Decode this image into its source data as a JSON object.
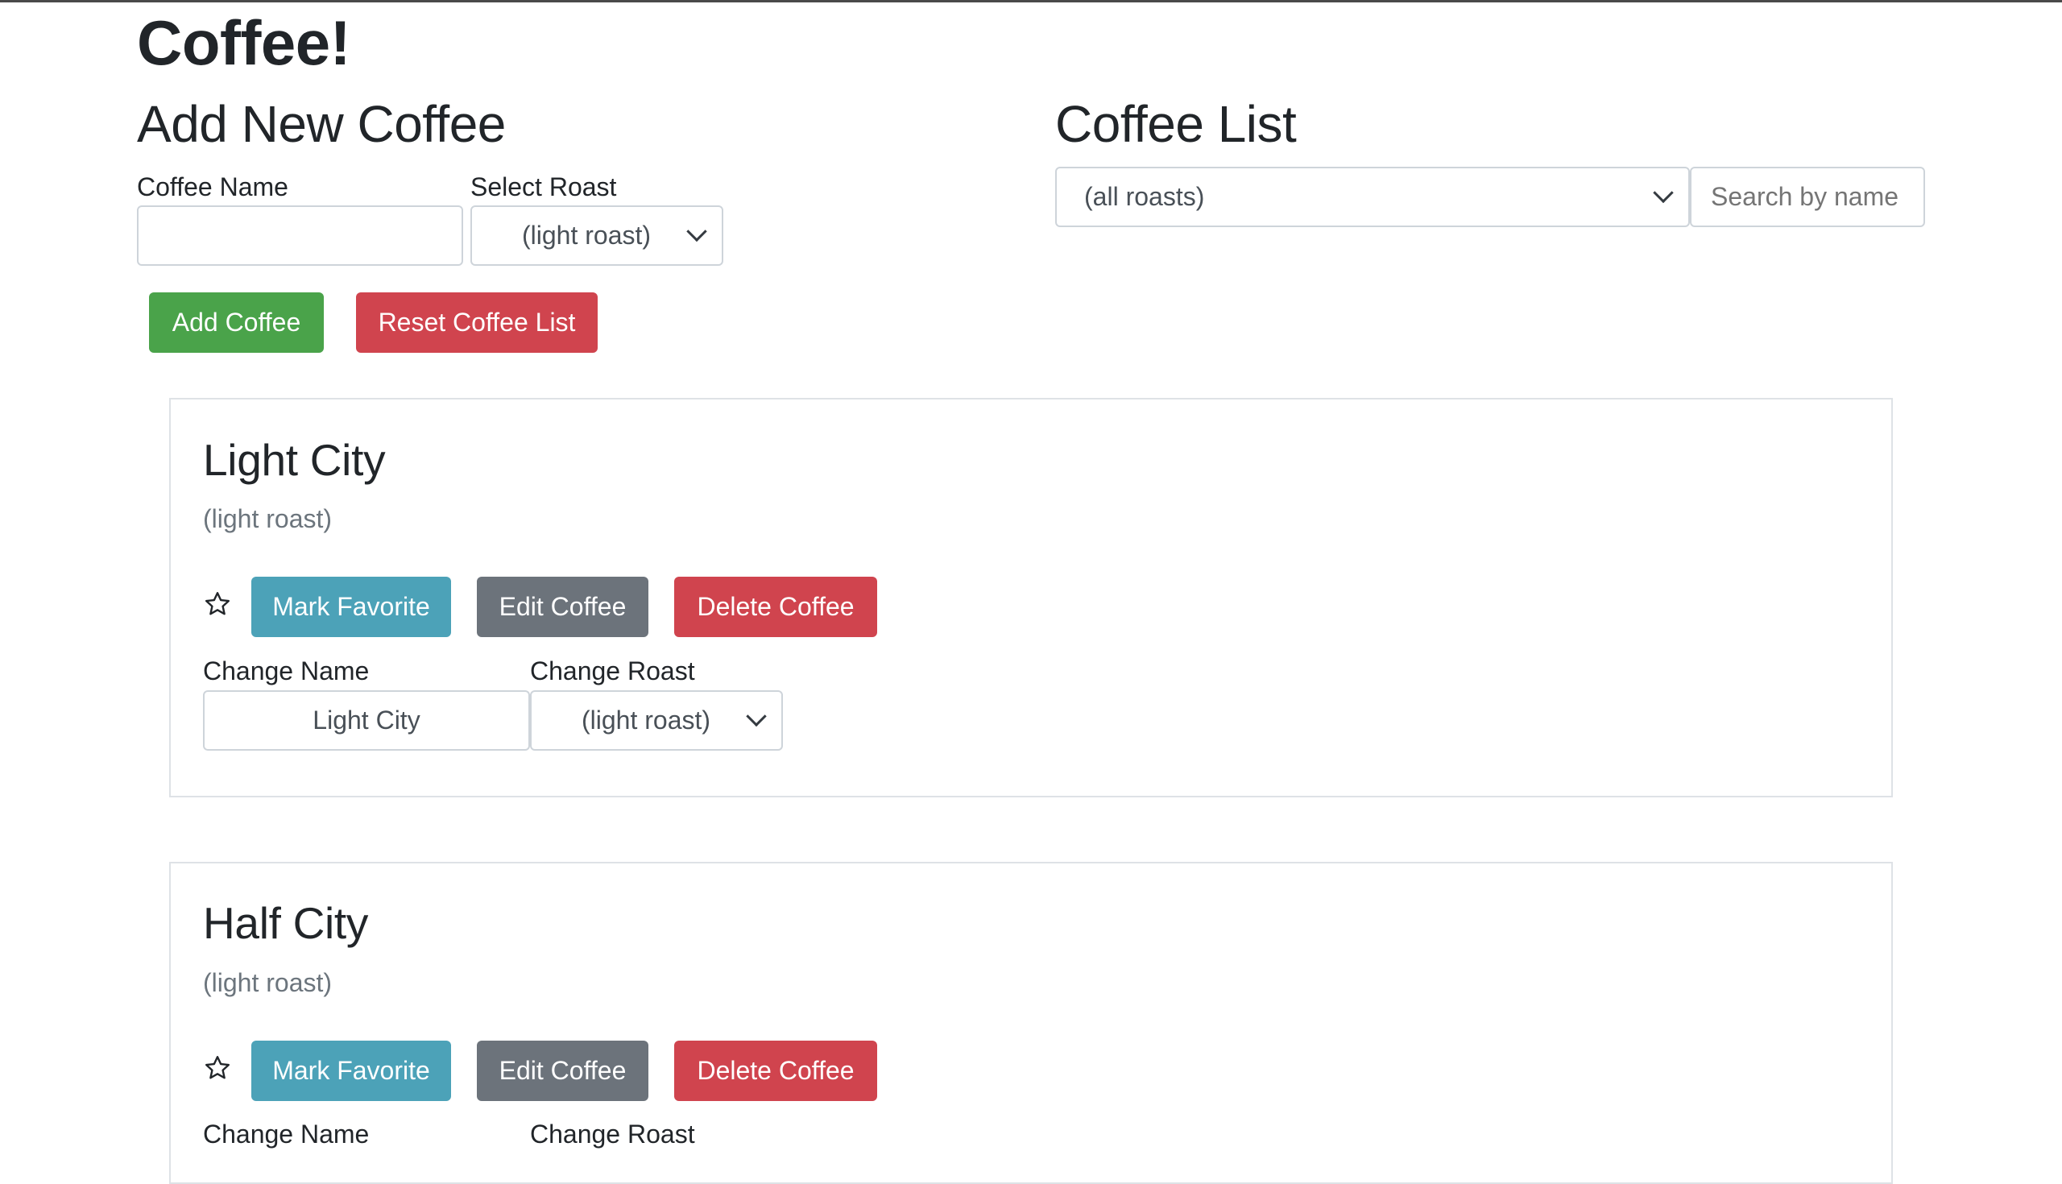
{
  "app": {
    "title": "Coffee!"
  },
  "add_form": {
    "heading": "Add New Coffee",
    "name_label": "Coffee Name",
    "name_value": "",
    "roast_label": "Select Roast",
    "roast_value": "(light roast)",
    "add_button": "Add Coffee",
    "reset_button": "Reset Coffee List"
  },
  "list": {
    "heading": "Coffee List",
    "filter_value": "(all roasts)",
    "search_placeholder": "Search by name"
  },
  "coffees": [
    {
      "name": "Light City",
      "roast": "(light roast)",
      "favorite_button": "Mark Favorite",
      "edit_button": "Edit Coffee",
      "delete_button": "Delete Coffee",
      "change_name_label": "Change Name",
      "change_name_value": "Light City",
      "change_roast_label": "Change Roast",
      "change_roast_value": "(light roast)"
    },
    {
      "name": "Half City",
      "roast": "(light roast)",
      "favorite_button": "Mark Favorite",
      "edit_button": "Edit Coffee",
      "delete_button": "Delete Coffee",
      "change_name_label": "Change Name",
      "change_roast_label": "Change Roast"
    }
  ],
  "colors": {
    "success": "#4aa34a",
    "danger": "#d0444e",
    "info": "#4ca2b8",
    "secondary": "#6c737b"
  },
  "icons": {
    "favorite": "star-outline-icon",
    "select": "chevron-down-icon"
  }
}
